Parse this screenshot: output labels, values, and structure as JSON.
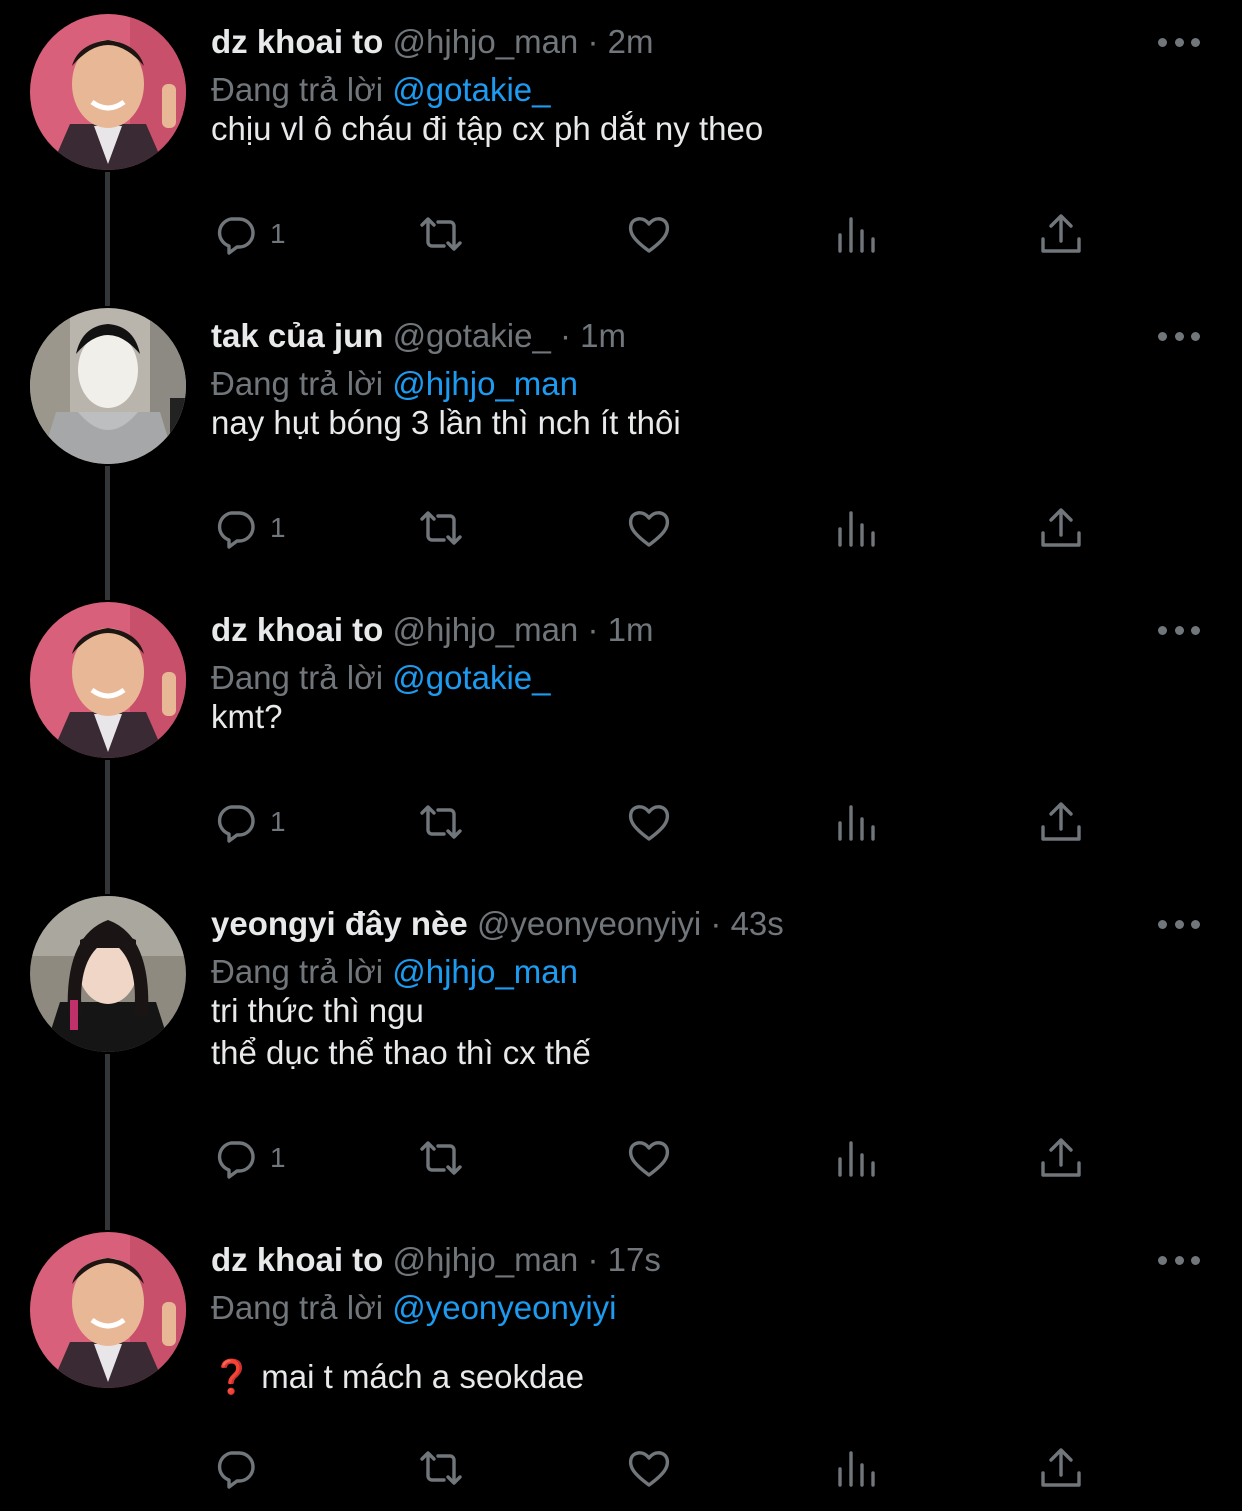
{
  "reply_prefix": "Đang trả lời",
  "colors": {
    "background": "#000000",
    "text": "#e7e9ea",
    "muted": "#71767b",
    "mention": "#1d9bf0",
    "thread_line": "#333639"
  },
  "tweets": [
    {
      "name": "dz khoai to",
      "handle": "@hjhjo_man",
      "dot": "·",
      "time": "2m",
      "reply_to": "@gotakie_",
      "text": "chịu vl ô cháu đi tập cx ph dắt ny theo",
      "reply_count": "1",
      "avatar": "avatar-smiling-man"
    },
    {
      "name": "tak của jun",
      "handle": "@gotakie_",
      "dot": "·",
      "time": "1m",
      "reply_to": "@hjhjo_man",
      "text": "nay hụt bóng 3 lần thì nch ít thôi",
      "reply_count": "1",
      "avatar": "avatar-boy-hoodie"
    },
    {
      "name": "dz khoai to",
      "handle": "@hjhjo_man",
      "dot": "·",
      "time": "1m",
      "reply_to": "@gotakie_",
      "text": "kmt?",
      "reply_count": "1",
      "avatar": "avatar-smiling-man"
    },
    {
      "name": "yeongyi đây nèe",
      "handle": "@yeonyeonyiyi",
      "dot": "·",
      "time": "43s",
      "reply_to": "@hjhjo_man",
      "text": "tri thức thì ngu\nthể dục thể thao thì cx thế",
      "reply_count": "1",
      "avatar": "avatar-girl-bangs"
    },
    {
      "name": "dz khoai to",
      "handle": "@hjhjo_man",
      "dot": "·",
      "time": "17s",
      "reply_to": "@yeonyeonyiyi",
      "emoji": "❓",
      "text": " mai t mách a seokdae",
      "reply_count": "",
      "avatar": "avatar-smiling-man"
    }
  ],
  "icons": [
    "reply-icon",
    "retweet-icon",
    "like-icon",
    "views-icon",
    "share-icon",
    "more-icon"
  ]
}
